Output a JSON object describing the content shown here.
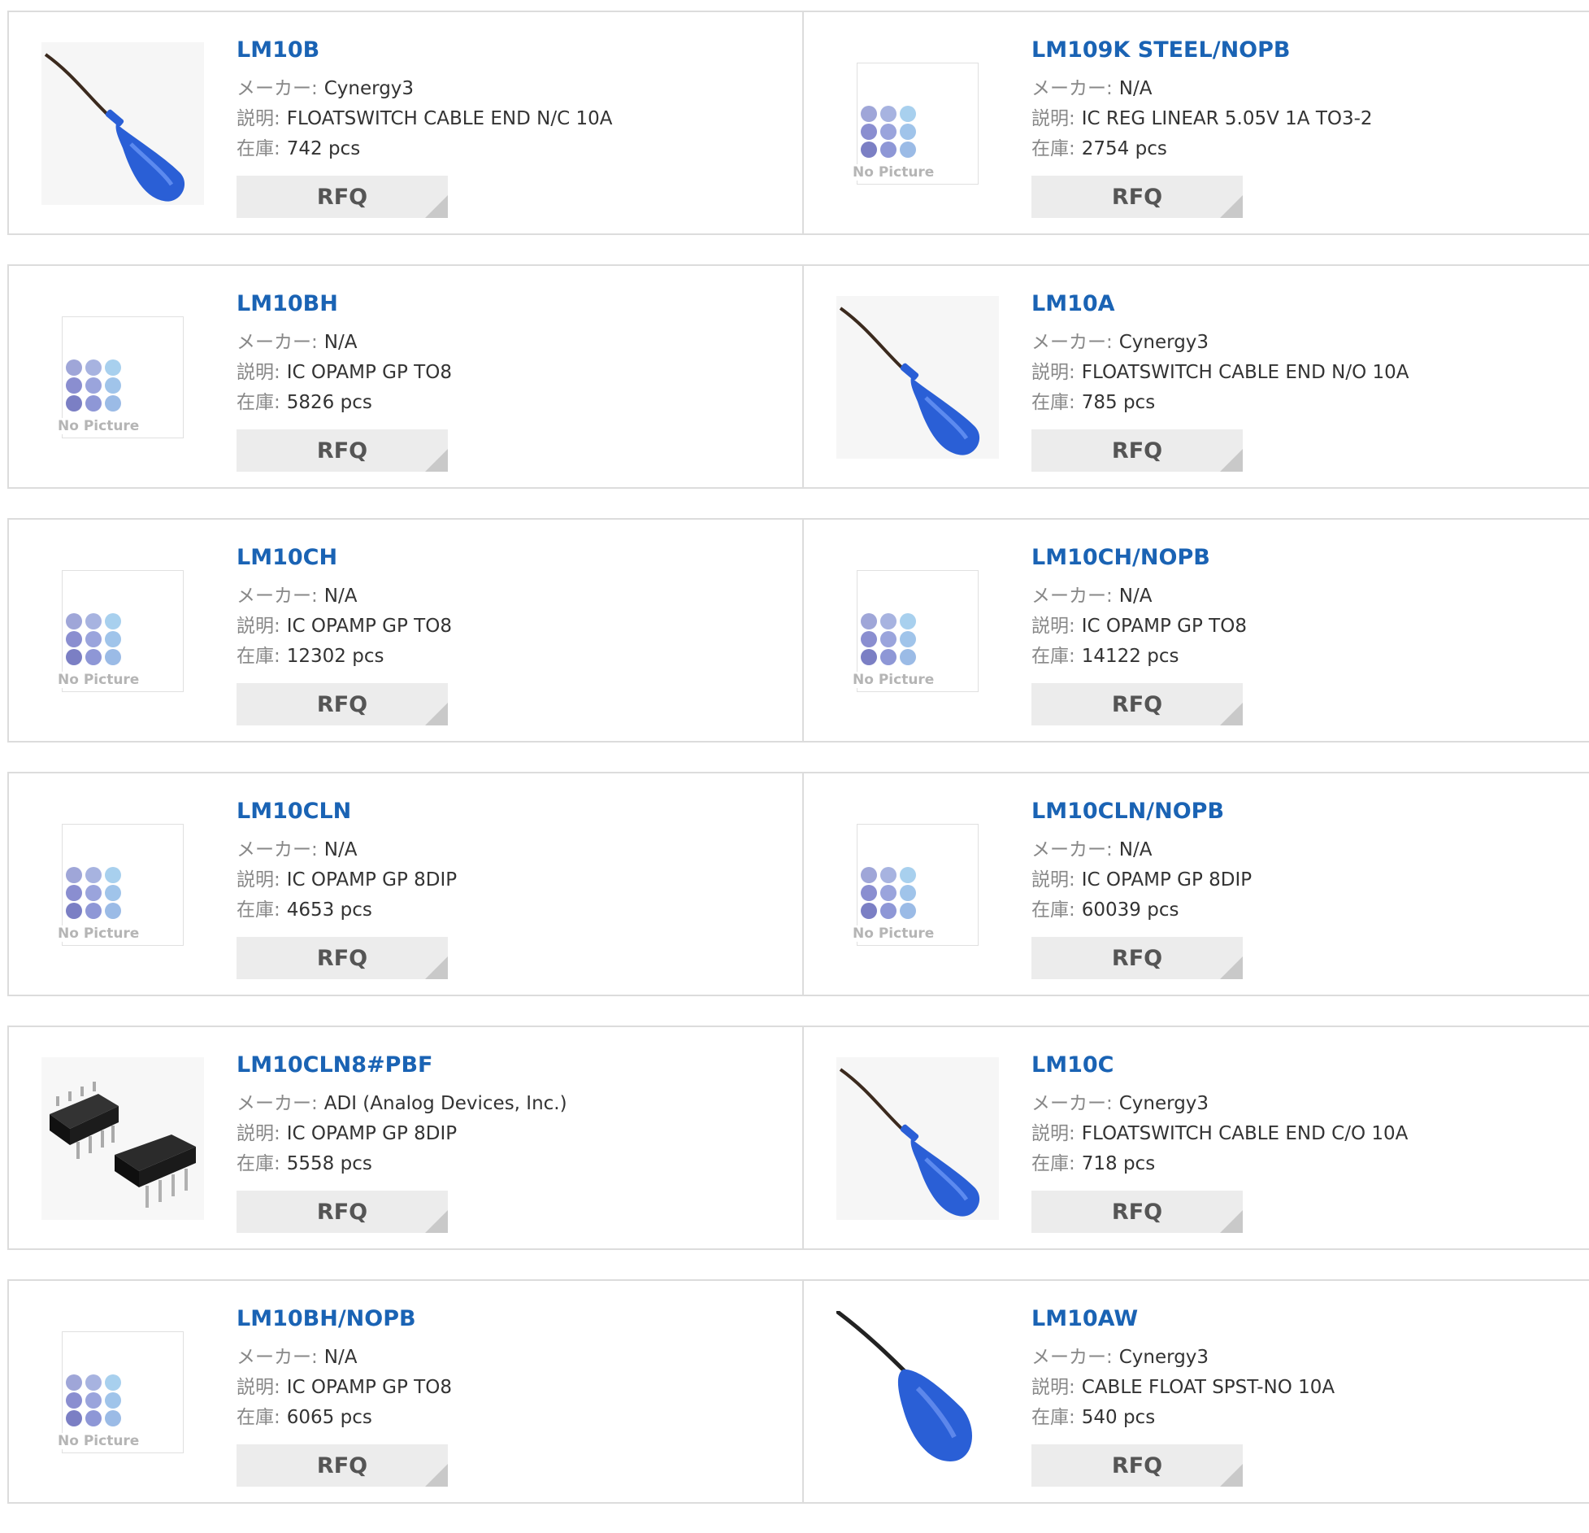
{
  "labels": {
    "maker": "メーカー:",
    "description": "説明:",
    "stock": "在庫:",
    "rfq": "RFQ",
    "no_picture": "No Picture"
  },
  "colors": {
    "part_link": "#1a63b4",
    "float_blue": "#2a5fd6",
    "rfq_bg": "#ececec"
  },
  "products": [
    {
      "part": "LM10B",
      "maker": "Cynergy3",
      "desc": "FLOATSWITCH CABLE END N/C 10A",
      "stock": "742 pcs",
      "image": "float-switch"
    },
    {
      "part": "LM109K STEEL/NOPB",
      "maker": "N/A",
      "desc": "IC REG LINEAR 5.05V 1A TO3-2",
      "stock": "2754 pcs",
      "image": "no-picture"
    },
    {
      "part": "LM10BH",
      "maker": "N/A",
      "desc": "IC OPAMP GP TO8",
      "stock": "5826 pcs",
      "image": "no-picture"
    },
    {
      "part": "LM10A",
      "maker": "Cynergy3",
      "desc": "FLOATSWITCH CABLE END N/O 10A",
      "stock": "785 pcs",
      "image": "float-switch"
    },
    {
      "part": "LM10CH",
      "maker": "N/A",
      "desc": "IC OPAMP GP TO8",
      "stock": "12302 pcs",
      "image": "no-picture"
    },
    {
      "part": "LM10CH/NOPB",
      "maker": "N/A",
      "desc": "IC OPAMP GP TO8",
      "stock": "14122 pcs",
      "image": "no-picture"
    },
    {
      "part": "LM10CLN",
      "maker": "N/A",
      "desc": "IC OPAMP GP 8DIP",
      "stock": "4653 pcs",
      "image": "no-picture"
    },
    {
      "part": "LM10CLN/NOPB",
      "maker": "N/A",
      "desc": "IC OPAMP GP 8DIP",
      "stock": "60039 pcs",
      "image": "no-picture"
    },
    {
      "part": "LM10CLN8#PBF",
      "maker": "ADI (Analog Devices, Inc.)",
      "desc": "IC OPAMP GP 8DIP",
      "stock": "5558 pcs",
      "image": "dip-ic"
    },
    {
      "part": "LM10C",
      "maker": "Cynergy3",
      "desc": "FLOATSWITCH CABLE END C/O 10A",
      "stock": "718 pcs",
      "image": "float-switch"
    },
    {
      "part": "LM10BH/NOPB",
      "maker": "N/A",
      "desc": "IC OPAMP GP TO8",
      "stock": "6065 pcs",
      "image": "no-picture"
    },
    {
      "part": "LM10AW",
      "maker": "Cynergy3",
      "desc": "CABLE FLOAT SPST-NO 10A",
      "stock": "540 pcs",
      "image": "float-ball"
    }
  ]
}
